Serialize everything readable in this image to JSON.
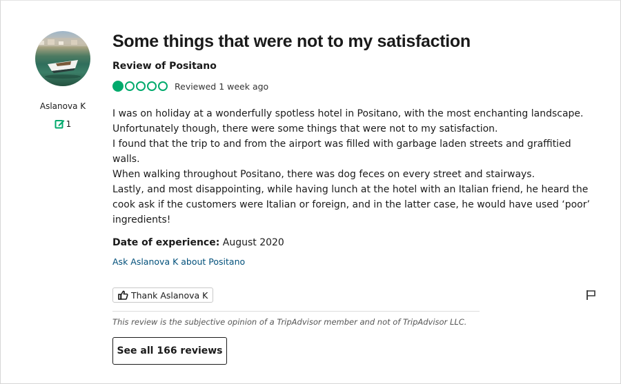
{
  "review": {
    "title": "Some things that were not to my satisfaction",
    "subtitle": "Review of Positano",
    "rating": 1,
    "rating_max": 5,
    "reviewed": "Reviewed 1 week ago",
    "body": [
      "I was on holiday at a wonderfully spotless hotel in Positano, with the most enchanting landscape. Unfortunately though, there were some things that were not to my satisfaction.",
      "I found that the trip to and from the airport was filled with garbage laden streets and graffitied walls.",
      "When walking throughout Positano, there was dog feces on every street and stairways.",
      "Lastly, and most disappointing, while having lunch at the hotel with an Italian friend, he heard the cook ask if the customers were Italian or foreign, and in the latter case, he would have used ‘poor’ ingredients!"
    ],
    "date_label": "Date of experience:",
    "date_value": "August 2020",
    "ask_link": "Ask Aslanova K about Positano",
    "thank_label": "Thank Aslanova K",
    "disclaimer": "This review is the subjective opinion of a TripAdvisor member and not of TripAdvisor LLC.",
    "see_all_label": "See all 166 reviews"
  },
  "reviewer": {
    "name": "Aslanova K",
    "contributions": "1"
  },
  "colors": {
    "bubble": "#00aa6c",
    "link": "#004f7a"
  },
  "icons": [
    "avatar-photo",
    "edit-icon",
    "thumbs-up-icon",
    "flag-icon",
    "rating-bubble"
  ]
}
